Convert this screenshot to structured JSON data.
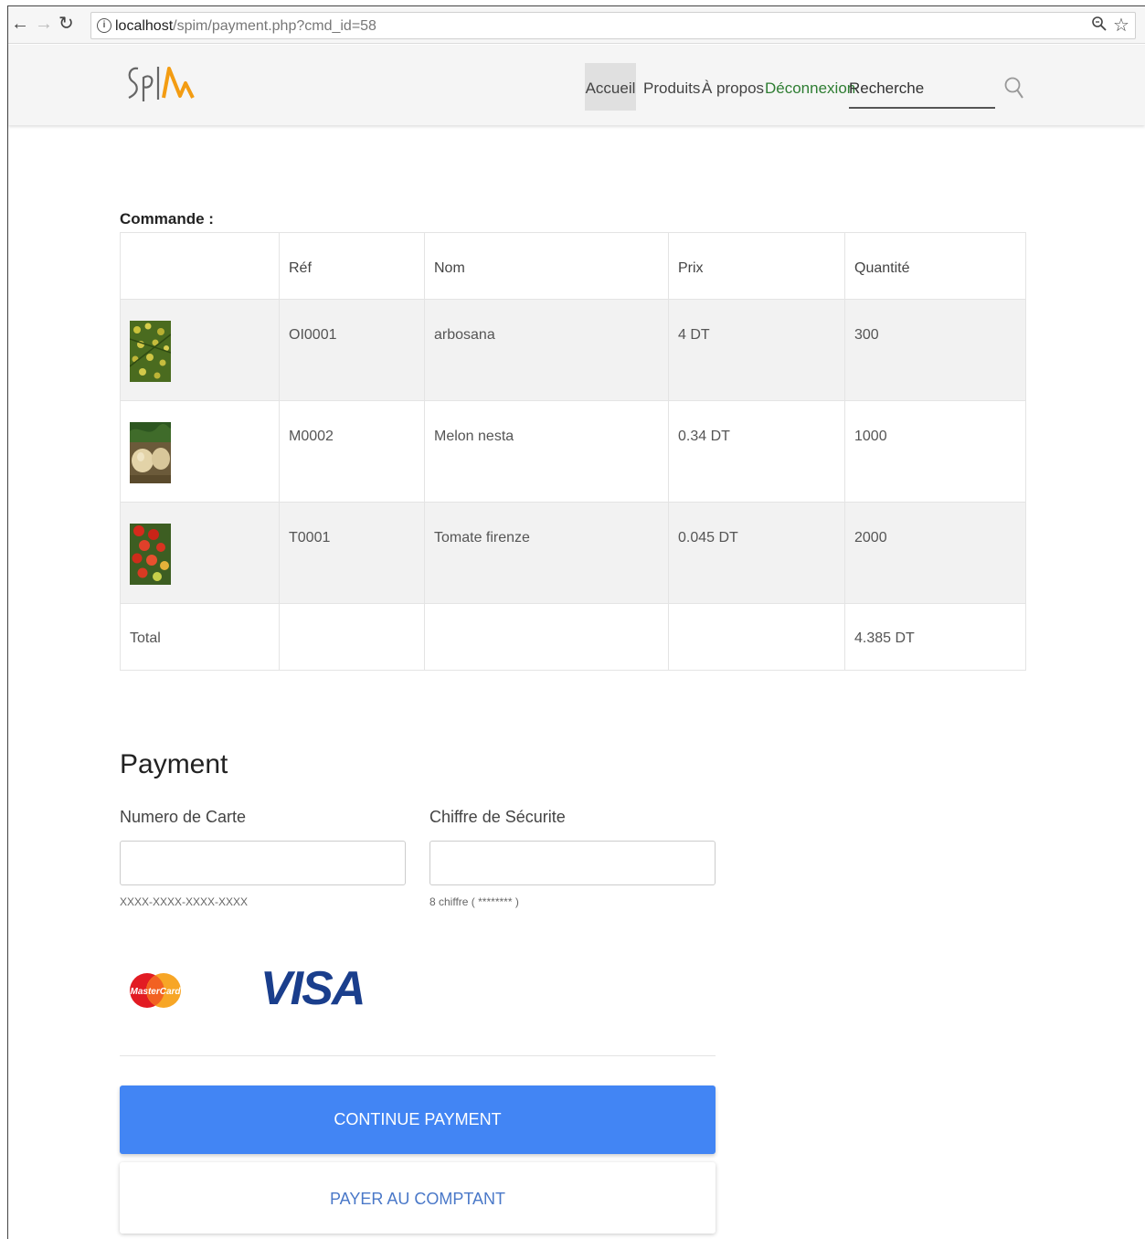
{
  "browser": {
    "url_host": "localhost",
    "url_path": "/spim/payment.php?cmd_id=58"
  },
  "site": {
    "logo_text": "SPIM",
    "nav": {
      "home": "Accueil",
      "products": "Produits",
      "about": "À propos",
      "logout": "Déconnexion"
    },
    "search_placeholder": "Recherche"
  },
  "order": {
    "title": "Commande :",
    "headers": [
      "",
      "Réf",
      "Nom",
      "Prix",
      "Quantité"
    ],
    "rows": [
      {
        "ref": "OI0001",
        "name": "arbosana",
        "price": "4  DT",
        "qty": "300",
        "image": "olive-thumbnail"
      },
      {
        "ref": "M0002",
        "name": "Melon nesta",
        "price": "0.34  DT",
        "qty": "1000",
        "image": "melon-thumbnail"
      },
      {
        "ref": "T0001",
        "name": "Tomate firenze",
        "price": "0.045  DT",
        "qty": "2000",
        "image": "tomato-thumbnail"
      }
    ],
    "total_label": "Total",
    "total_value": "4.385  DT"
  },
  "payment": {
    "title": "Payment",
    "card_number_label": "Numero de Carte",
    "card_number_hint": "XXXX-XXXX-XXXX-XXXX",
    "security_label": "Chiffre de Sécurite",
    "security_hint": "8 chiffre ( ******** )",
    "mastercard_text": "MasterCard",
    "visa_text": "VISA",
    "continue_label": "CONTINUE PAYMENT",
    "cash_label": "PAYER AU COMPTANT"
  },
  "colors": {
    "primary_button": "#4285f4",
    "logo_orange": "#f39c12",
    "logout_green": "#2e7d32",
    "visa_blue": "#1a3e8c"
  }
}
